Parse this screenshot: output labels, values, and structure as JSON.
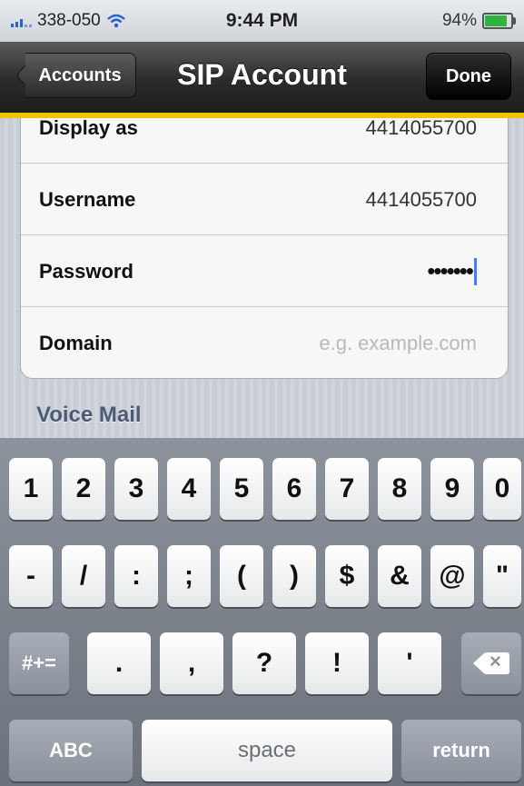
{
  "status_bar": {
    "carrier": "338-050",
    "time": "9:44 PM",
    "battery": "94%",
    "battery_level": 0.94
  },
  "nav": {
    "back_label": "Accounts",
    "title": "SIP Account",
    "done_label": "Done"
  },
  "form": {
    "rows": [
      {
        "label": "Display as",
        "value": "4414055700"
      },
      {
        "label": "Username",
        "value": "4414055700"
      },
      {
        "label": "Password",
        "value": "•••••••"
      },
      {
        "label": "Domain",
        "placeholder": "e.g. example.com"
      }
    ],
    "section_header": "Voice Mail"
  },
  "keyboard": {
    "row1": [
      "1",
      "2",
      "3",
      "4",
      "5",
      "6",
      "7",
      "8",
      "9",
      "0"
    ],
    "row2": [
      "-",
      "/",
      ":",
      ";",
      "(",
      ")",
      "$",
      "&",
      "@",
      "\""
    ],
    "row3": [
      "#+=",
      ".",
      ",",
      "?",
      "!",
      "'"
    ],
    "row4": {
      "abc": "ABC",
      "space": "space",
      "return": "return"
    },
    "icons": {
      "backspace": "backspace-icon"
    }
  }
}
